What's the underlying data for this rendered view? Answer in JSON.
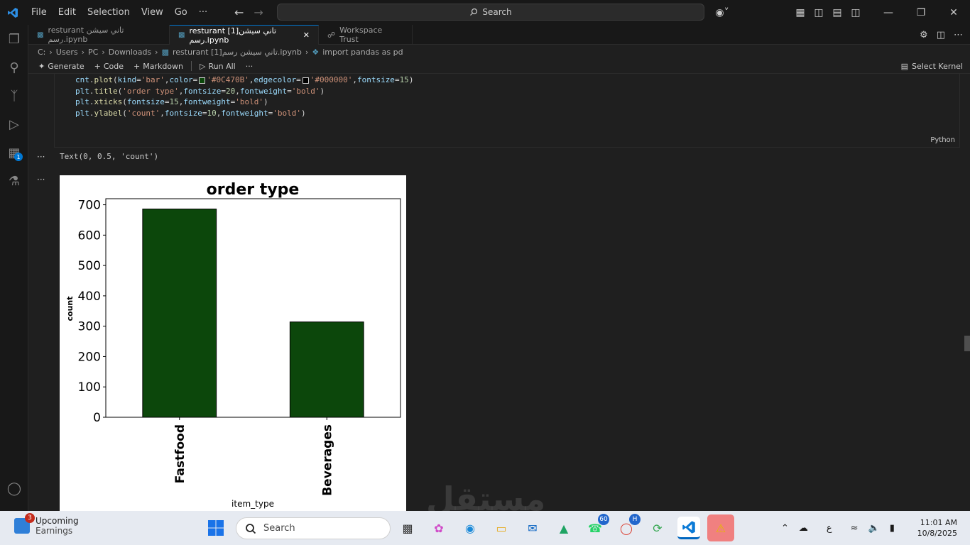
{
  "window": {
    "menu": [
      "File",
      "Edit",
      "Selection",
      "View",
      "Go",
      "···"
    ],
    "search_label": "Search"
  },
  "tabs": [
    {
      "label": "resturant تاني سيشن رسم.ipynb",
      "active": false
    },
    {
      "label": "resturant [1]تاني سيشن رسم.ipynb",
      "active": true
    },
    {
      "label": "Workspace Trust",
      "active": false
    }
  ],
  "breadcrumb": [
    "C:",
    "Users",
    "PC",
    "Downloads",
    "resturant [1]تاني سيشن رسم.ipynb",
    "import pandas as pd"
  ],
  "toolbar": {
    "generate": "Generate",
    "code": "Code",
    "markdown": "Markdown",
    "run_all": "Run All",
    "more": "···",
    "select_kernel": "Select Kernel"
  },
  "cell": {
    "language": "Python",
    "lines": [
      "cnt.plot(kind='bar',color='#0C470B',edgecolor='#000000',fontsize=15)",
      "plt.title('order type',fontsize=20,fontweight='bold')",
      "plt.xticks(fontsize=15,fontweight='bold')",
      "plt.ylabel('count',fontsize=10,fontweight='bold')"
    ],
    "output_text": "Text(0, 0.5, 'count')",
    "output_dots": "···"
  },
  "chart_data": {
    "type": "bar",
    "title": "order type",
    "categories": [
      "Fastfood",
      "Beverages"
    ],
    "values": [
      686,
      314
    ],
    "xlabel": "item_type",
    "ylabel": "count",
    "ylim": [
      0,
      720
    ],
    "yticks": [
      0,
      100,
      200,
      300,
      400,
      500,
      600,
      700
    ],
    "bar_color": "#0C470B",
    "edge_color": "#000000",
    "grid": false
  },
  "activity_badge": "1",
  "taskbar": {
    "weather_title": "Upcoming",
    "weather_sub": "Earnings",
    "weather_badge": "3",
    "search_placeholder": "Search",
    "whatsapp_badge": "60",
    "chrome_badge": "H",
    "lang": "ع",
    "time": "11:01 AM",
    "date": "10/8/2025"
  },
  "watermark": "مستقل"
}
